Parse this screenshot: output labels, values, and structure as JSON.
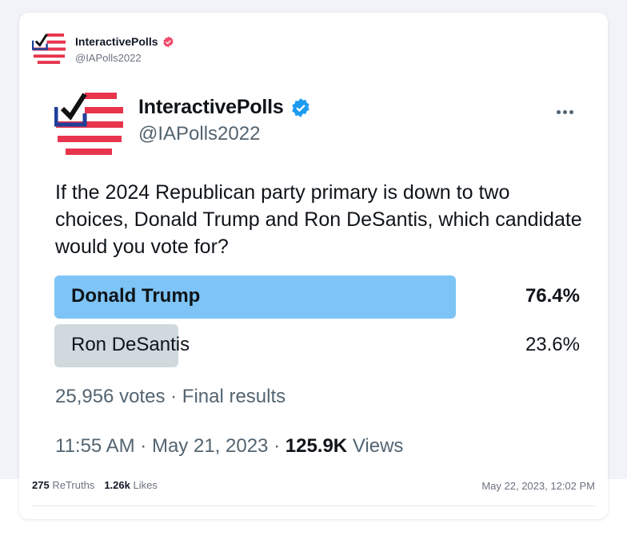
{
  "post": {
    "author_name": "InteractivePolls",
    "author_handle": "@IAPolls2022",
    "verified_badge_color": "#ef4b6d"
  },
  "embed": {
    "author_name": "InteractivePolls",
    "author_handle": "@IAPolls2022",
    "verified_badge_color": "#1d9bf0",
    "more_icon": "more-horizontal-icon",
    "question": "If the 2024 Republican party primary is down to two choices, Donald Trump and Ron DeSantis, which candidate would you vote for?",
    "poll": {
      "options": [
        {
          "label": "Donald Trump",
          "percent_text": "76.4%",
          "percent": 76.4,
          "winner": true,
          "bar_color": "#7ec4f6"
        },
        {
          "label": "Ron DeSantis",
          "percent_text": "23.6%",
          "percent": 23.6,
          "winner": false,
          "bar_color": "#cfd9de"
        }
      ],
      "votes": "25,956 votes",
      "separator": "·",
      "status": "Final results"
    },
    "time": "11:55 AM",
    "date": "May 21, 2023",
    "views_count": "125.9K",
    "views_label": "Views"
  },
  "stats": {
    "retruths_count": "275",
    "retruths_label": "ReTruths",
    "likes_count": "1.26k",
    "likes_label": "Likes"
  },
  "timestamp": "May 22, 2023, 12:02 PM"
}
